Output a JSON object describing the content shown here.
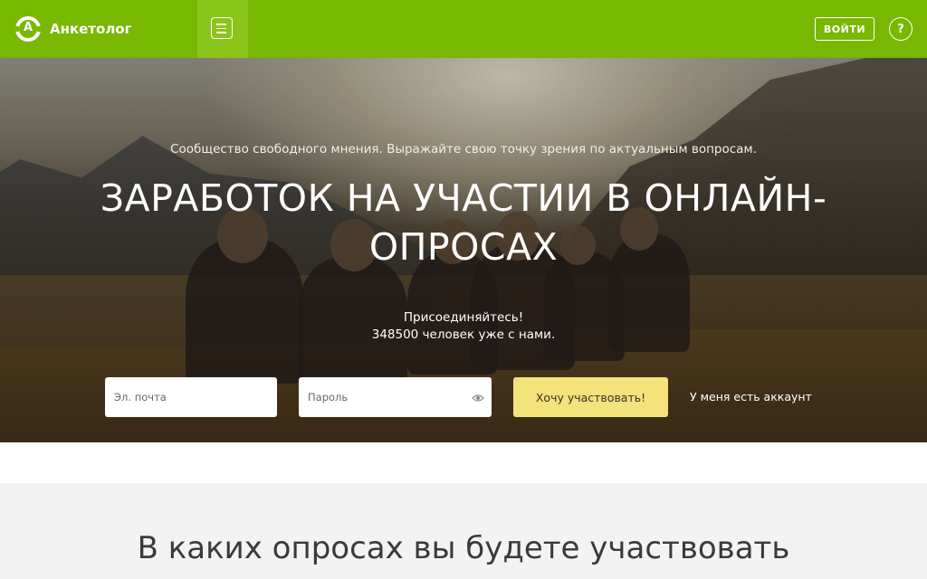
{
  "header": {
    "logo_letter": "А",
    "logo_text": "Анкетолог",
    "login_label": "ВОЙТИ",
    "help_label": "?",
    "accent_color": "#78b800",
    "icons": [
      "logo-ring-icon",
      "hamburger-menu-icon",
      "help-icon"
    ]
  },
  "hero": {
    "tagline": "Сообщество свободного мнения. Выражайте свою точку зрения по актуальным вопросам.",
    "title_line1": "ЗАРАБОТОК НА УЧАСТИИ В ОНЛАЙН-",
    "title_line2": "ОПРОСАХ",
    "join_line1": "Присоединяйтесь!",
    "join_line2": "348500 человек уже с нами."
  },
  "form": {
    "email_placeholder": "Эл. почта",
    "email_value": "",
    "password_placeholder": "Пароль",
    "password_value": "",
    "password_icon": "eye-icon",
    "submit_label": "Хочу участвовать!",
    "submit_color": "#f4e27a",
    "have_account_label": "У меня есть аккаунт"
  },
  "section": {
    "title": "В каких опросах вы будете участвовать"
  }
}
